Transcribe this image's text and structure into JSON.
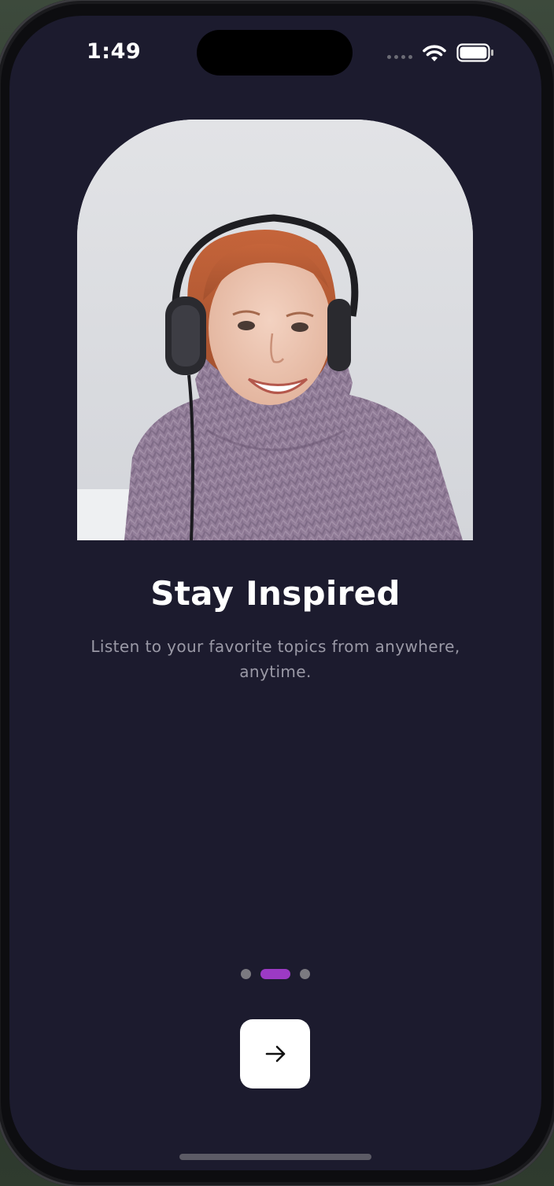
{
  "status_bar": {
    "time": "1:49",
    "wifi_icon": "wifi-icon",
    "battery_icon": "battery-icon",
    "signal_icon": "cellular-signal-icon"
  },
  "onboarding": {
    "title": "Stay Inspired",
    "subtitle": "Listen to your favorite topics from anywhere, anytime.",
    "page_count": 3,
    "active_page": 2,
    "next_button_icon": "arrow-right-icon"
  },
  "colors": {
    "background": "#1c1b2e",
    "accent": "#9c3ac4",
    "title": "#ffffff",
    "subtitle": "#9a99a6",
    "inactive_dot": "#7b7a80",
    "button": "#ffffff"
  }
}
